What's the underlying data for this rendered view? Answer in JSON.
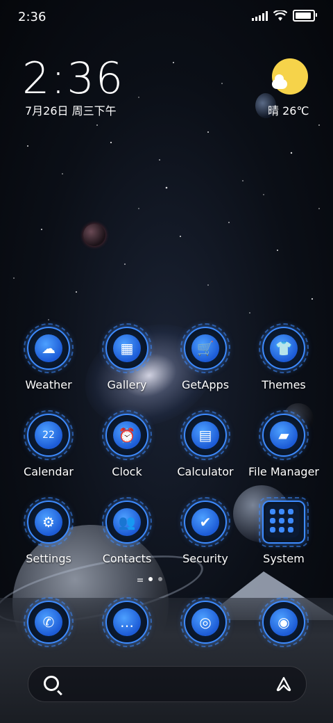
{
  "status_bar": {
    "time": "2:36"
  },
  "lockscreen": {
    "clock": "2:36",
    "date": "7月26日 周三下午",
    "weather": "晴 26℃"
  },
  "apps": [
    {
      "name": "Weather",
      "glyph": "☁"
    },
    {
      "name": "Gallery",
      "glyph": "▦"
    },
    {
      "name": "GetApps",
      "glyph": "🛒"
    },
    {
      "name": "Themes",
      "glyph": "👕"
    },
    {
      "name": "Calendar",
      "glyph": "22"
    },
    {
      "name": "Clock",
      "glyph": "⏰"
    },
    {
      "name": "Calculator",
      "glyph": "▤"
    },
    {
      "name": "File Manager",
      "glyph": "▰"
    },
    {
      "name": "Settings",
      "glyph": "⚙"
    },
    {
      "name": "Contacts",
      "glyph": "👥"
    },
    {
      "name": "Security",
      "glyph": "✔"
    },
    {
      "name": "System",
      "glyph": ""
    }
  ],
  "dock": [
    {
      "glyph": "✆"
    },
    {
      "glyph": "…"
    },
    {
      "glyph": "◎"
    },
    {
      "glyph": "◉"
    }
  ],
  "page_indicator": {
    "current": 2,
    "total": 3
  },
  "colors": {
    "accent": "#3d8bff",
    "sun": "#f6d34a"
  }
}
